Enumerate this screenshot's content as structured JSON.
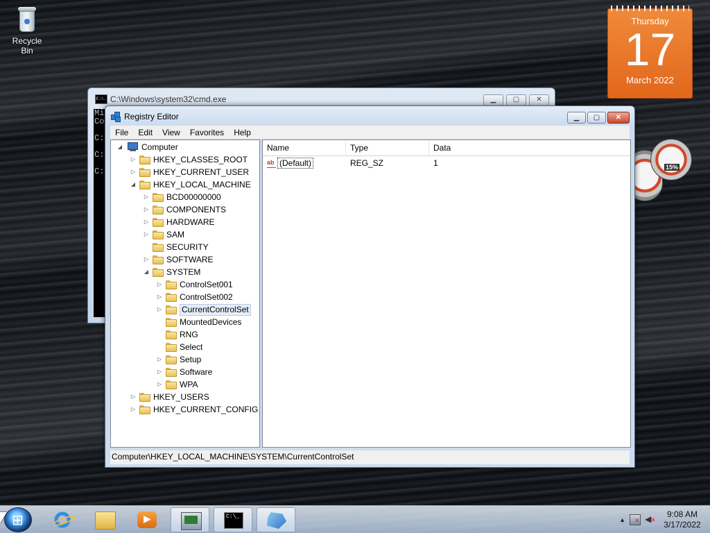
{
  "desktop": {
    "recycle_bin_label": "Recycle Bin"
  },
  "calendar_gadget": {
    "weekday": "Thursday",
    "day": "17",
    "month_year": "March 2022"
  },
  "meter_gadget": {
    "percent_label": "15%"
  },
  "cmd_window": {
    "title": "C:\\Windows\\system32\\cmd.exe",
    "icon_text": "C:\\.",
    "visible_text": "Mi\nCo\n\nC:\n\nC:\n\nC:"
  },
  "regedit": {
    "title": "Registry Editor",
    "menu": [
      "File",
      "Edit",
      "View",
      "Favorites",
      "Help"
    ],
    "tree": [
      {
        "label": "Computer",
        "expander": "◢",
        "icon": "computer"
      },
      {
        "label": "HKEY_CLASSES_ROOT",
        "expander": "▷",
        "icon": "folder"
      },
      {
        "label": "HKEY_CURRENT_USER",
        "expander": "▷",
        "icon": "folder"
      },
      {
        "label": "HKEY_LOCAL_MACHINE",
        "expander": "◢",
        "icon": "folder"
      },
      {
        "label": "BCD00000000",
        "expander": "▷",
        "icon": "folder"
      },
      {
        "label": "COMPONENTS",
        "expander": "▷",
        "icon": "folder"
      },
      {
        "label": "HARDWARE",
        "expander": "▷",
        "icon": "folder"
      },
      {
        "label": "SAM",
        "expander": "▷",
        "icon": "folder"
      },
      {
        "label": "SECURITY",
        "expander": "",
        "icon": "folder"
      },
      {
        "label": "SOFTWARE",
        "expander": "▷",
        "icon": "folder"
      },
      {
        "label": "SYSTEM",
        "expander": "◢",
        "icon": "folder"
      },
      {
        "label": "ControlSet001",
        "expander": "▷",
        "icon": "folder"
      },
      {
        "label": "ControlSet002",
        "expander": "▷",
        "icon": "folder"
      },
      {
        "label": "CurrentControlSet",
        "expander": "▷",
        "icon": "folder",
        "selected": true
      },
      {
        "label": "MountedDevices",
        "expander": "",
        "icon": "folder"
      },
      {
        "label": "RNG",
        "expander": "",
        "icon": "folder"
      },
      {
        "label": "Select",
        "expander": "",
        "icon": "folder"
      },
      {
        "label": "Setup",
        "expander": "▷",
        "icon": "folder"
      },
      {
        "label": "Software",
        "expander": "▷",
        "icon": "folder"
      },
      {
        "label": "WPA",
        "expander": "▷",
        "icon": "folder"
      },
      {
        "label": "HKEY_USERS",
        "expander": "▷",
        "icon": "folder"
      },
      {
        "label": "HKEY_CURRENT_CONFIG",
        "expander": "▷",
        "icon": "folder"
      }
    ],
    "columns": [
      "Name",
      "Type",
      "Data"
    ],
    "values": [
      {
        "name": "(Default)",
        "type": "REG_SZ",
        "data": "1",
        "icon_text": "ab"
      }
    ],
    "status_path": "Computer\\HKEY_LOCAL_MACHINE\\SYSTEM\\CurrentControlSet"
  },
  "taskbar": {
    "cmd_glyph_text": "C:\\_",
    "clock_time": "9:08 AM",
    "clock_date": "3/17/2022",
    "tray_arrow": "▲"
  }
}
